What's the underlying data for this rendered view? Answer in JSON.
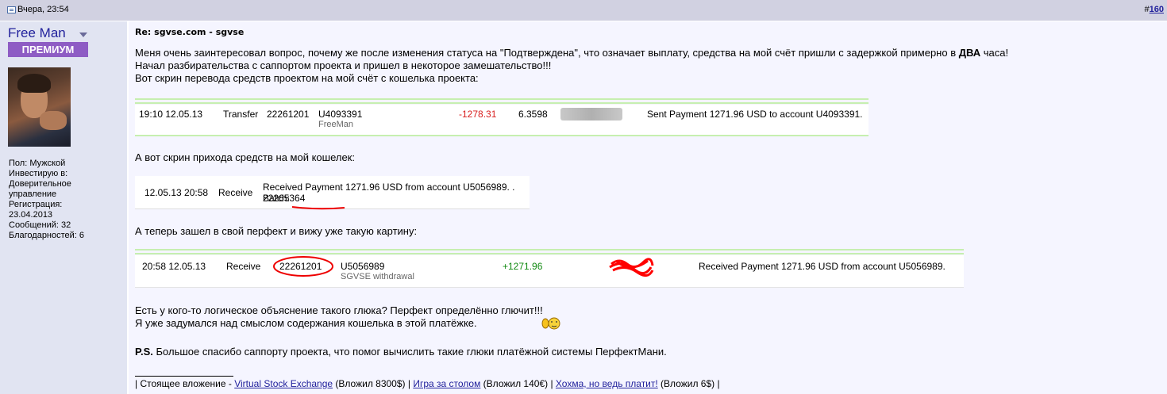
{
  "header": {
    "date": "Вчера, 23:54",
    "post_number": "160",
    "post_prefix": "#"
  },
  "user": {
    "name": "Free Man",
    "rank": "ПРЕМИУМ",
    "info": [
      "Пол: Мужской",
      "Инвестирую в:",
      "Доверительное",
      "управление",
      "Регистрация:",
      "23.04.2013",
      "Сообщений: 32",
      "Благодарностей: 6"
    ]
  },
  "post": {
    "title": "Re: sgvse.com - sgvse",
    "line1_a": "Меня очень заинтересовал вопрос, почему же после изменения статуса на \"Подтверждена\", что означает выплату, средства на мой счёт пришли с задержкой примерно в ",
    "line1_bold": "ДВА",
    "line1_b": " часа!",
    "line2": "Начал разбирательства с саппортом проекта и пришел в некоторое замешательство!!!",
    "line3": "Вот скрин перевода средств проектом на мой счёт с кошелька проекта:",
    "line4": "А вот скрин прихода средств на мой кошелек:",
    "line5": "А теперь зашел в свой перфект и вижу уже такую картину:",
    "line6": "Есть у кого-то логическое объяснение такого глюка? Перфект определённо глючит!!!",
    "line7": "Я уже задумался над смыслом содержания кошелька в этой платёжке.",
    "ps_label": "P.S.",
    "ps_text": " Большое спасибо саппорту проекта, что помог вычислить такие глюки платёжной системы ПерфектМани."
  },
  "shot1": {
    "time": "19:10 12.05.13",
    "type": "Transfer",
    "batch": "22261201",
    "account": "U4093391",
    "account_name": "FreeMan",
    "amount": "-1278.31",
    "fee": "6.3598",
    "memo": "Sent Payment 1271.96 USD to account U4093391."
  },
  "shot2": {
    "time": "12.05.13 20:58",
    "type": "Receive",
    "memo": "Received Payment 1271.96 USD from account U5056989. .",
    "batch_label": "Batch: ",
    "batch": "22265364"
  },
  "shot3": {
    "time": "20:58 12.05.13",
    "type": "Receive",
    "batch": "22261201",
    "account": "U5056989",
    "account_name": "SGVSE withdrawal",
    "amount": "+1271.96",
    "memo": "Received Payment 1271.96 USD from account U5056989."
  },
  "signature": {
    "lead": "| Стоящее вложение - ",
    "l1": "Virtual Stock Exchange",
    "t1": " (Вложил 8300$) | ",
    "l2": "Игра за столом",
    "t2": " (Вложил 140€) | ",
    "l3": "Хохма, но ведь платит!",
    "t3": " (Вложил 6$) |"
  }
}
